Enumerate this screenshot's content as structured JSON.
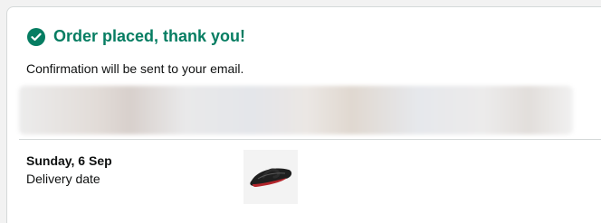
{
  "order": {
    "title": "Order placed, thank you!",
    "confirmation": "Confirmation will be sent to your email.",
    "delivery_date": "Sunday, 6 Sep",
    "delivery_label": "Delivery date",
    "product_icon": "flip-flop-sandal",
    "accent_color": "#067d62"
  }
}
